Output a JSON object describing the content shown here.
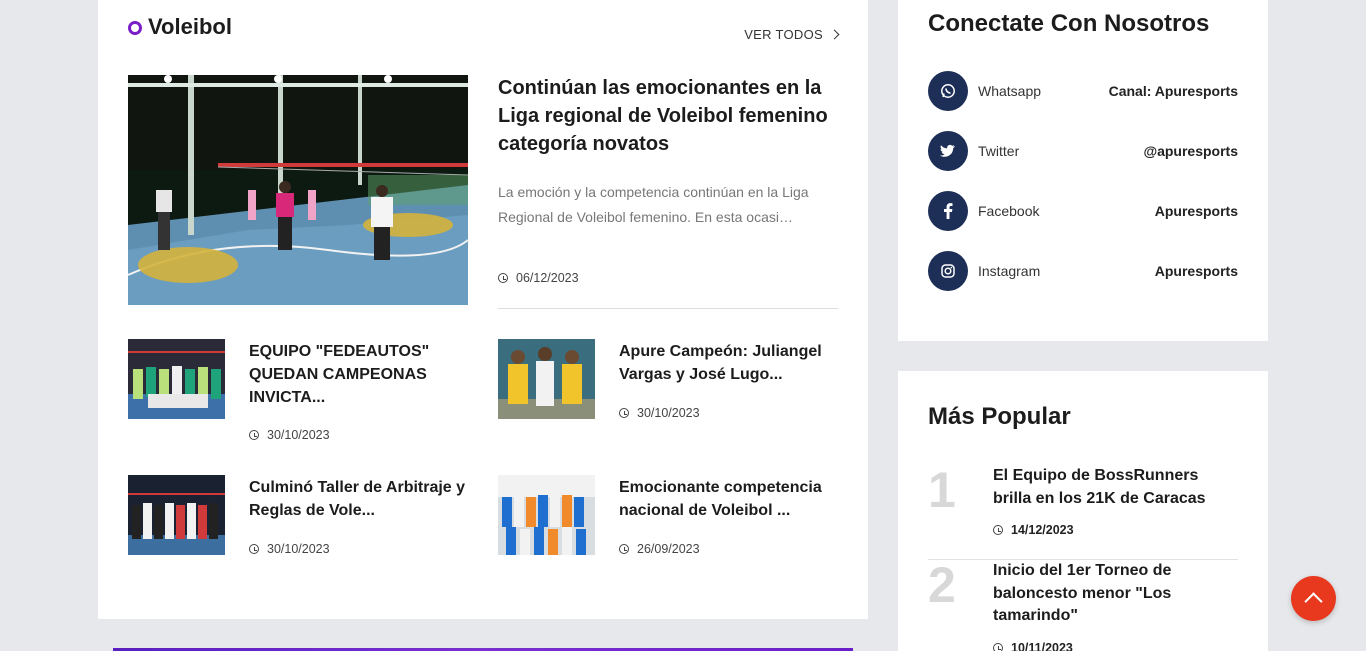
{
  "section": {
    "title": "Voleibol",
    "see_all": "VER TODOS"
  },
  "featured": {
    "title": "Continúan las emocionantes en la Liga regional de Voleibol femenino categoría novatos",
    "excerpt": "La emoción y la competencia continúan en la Liga Regional de Voleibol femenino.   En esta ocasi…",
    "date": "06/12/2023"
  },
  "articles": [
    {
      "title": "EQUIPO \"FEDEAUTOS\" QUEDAN CAMPEONAS INVICTA...",
      "date": "30/10/2023"
    },
    {
      "title": "Apure Campeón: Juliangel Vargas y José Lugo...",
      "date": "30/10/2023"
    },
    {
      "title": "Culminó Taller de Arbitraje y Reglas de Vole...",
      "date": "30/10/2023"
    },
    {
      "title": "Emocionante competencia nacional de Voleibol ...",
      "date": "26/09/2023"
    }
  ],
  "connect": {
    "title": "Conectate Con Nosotros",
    "items": [
      {
        "icon": "whatsapp-icon",
        "name": "Whatsapp",
        "handle": "Canal: Apuresports"
      },
      {
        "icon": "twitter-icon",
        "name": "Twitter",
        "handle": "@apuresports"
      },
      {
        "icon": "facebook-icon",
        "name": "Facebook",
        "handle": "Apuresports"
      },
      {
        "icon": "instagram-icon",
        "name": "Instagram",
        "handle": "Apuresports"
      }
    ]
  },
  "popular": {
    "title": "Más Popular",
    "items": [
      {
        "rank": "1",
        "title": "El Equipo de BossRunners brilla en los 21K de Caracas",
        "date": "14/12/2023"
      },
      {
        "rank": "2",
        "title": "Inicio del 1er Torneo de baloncesto menor \"Los tamarindo\"",
        "date": "10/11/2023"
      }
    ]
  },
  "colors": {
    "accent": "#7a1fc7",
    "social_bg": "#1d2e57",
    "scroll_button": "#e8391f"
  }
}
